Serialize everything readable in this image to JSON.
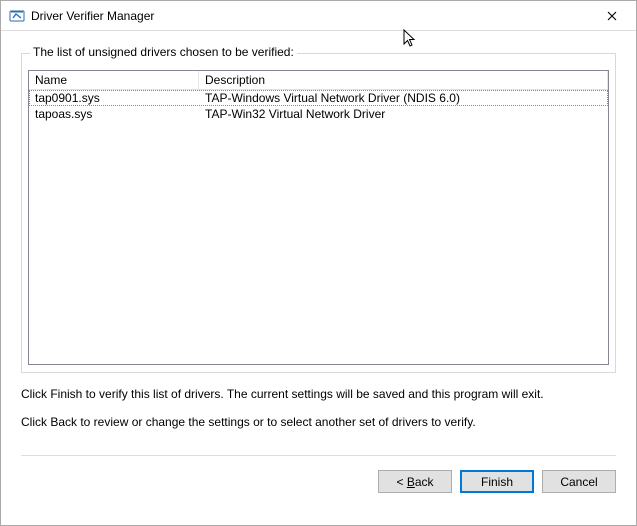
{
  "window": {
    "title": "Driver Verifier Manager"
  },
  "group": {
    "label": "The list of unsigned drivers chosen to be verified:"
  },
  "columns": {
    "name": "Name",
    "description": "Description"
  },
  "rows": [
    {
      "name": "tap0901.sys",
      "description": "TAP-Windows Virtual Network Driver (NDIS 6.0)"
    },
    {
      "name": "tapoas.sys",
      "description": "TAP-Win32 Virtual Network Driver"
    }
  ],
  "instructions": {
    "line1": "Click Finish to verify this list of drivers. The current settings will be saved and this program will exit.",
    "line2": "Click Back to review or change the settings or to select another set of drivers to verify."
  },
  "buttons": {
    "back_prefix": "< ",
    "back_access": "B",
    "back_rest": "ack",
    "finish": "Finish",
    "cancel": "Cancel"
  }
}
